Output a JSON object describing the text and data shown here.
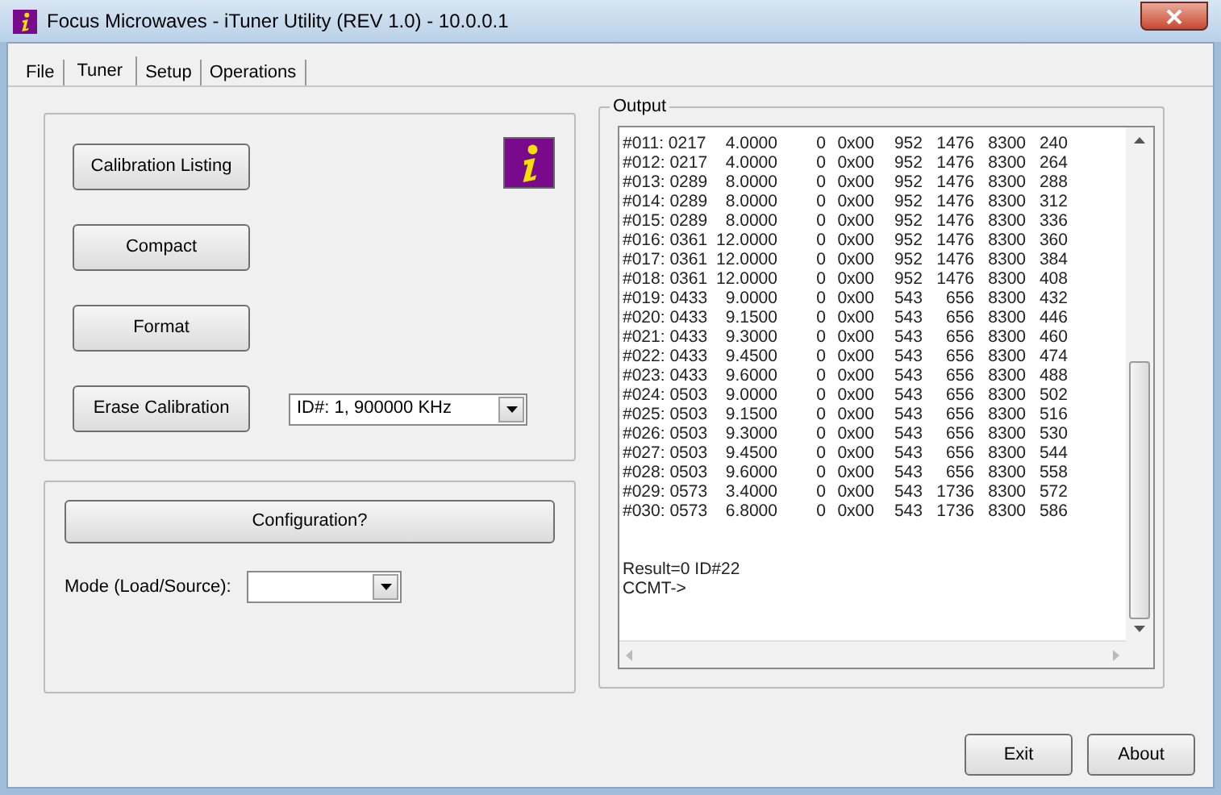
{
  "window": {
    "title": "Focus Microwaves - iTuner Utility (REV 1.0) - 10.0.0.1"
  },
  "tabs": [
    {
      "label": "File",
      "selected": false
    },
    {
      "label": "Tuner",
      "selected": true
    },
    {
      "label": "Setup",
      "selected": false
    },
    {
      "label": "Operations",
      "selected": false
    }
  ],
  "tuner_panel": {
    "buttons": [
      "Calibration Listing",
      "Compact",
      "Format",
      "Erase Calibration"
    ],
    "calibration_select": {
      "value": "ID#: 1, 900000 KHz"
    }
  },
  "config_panel": {
    "button": "Configuration?",
    "mode_label": "Mode (Load/Source):"
  },
  "output": {
    "title": "Output",
    "rows": [
      [
        "#011: 0217",
        "4.0000",
        "0",
        "0x00",
        "952",
        "1476",
        "8300",
        "240"
      ],
      [
        "#012: 0217",
        "4.0000",
        "0",
        "0x00",
        "952",
        "1476",
        "8300",
        "264"
      ],
      [
        "#013: 0289",
        "8.0000",
        "0",
        "0x00",
        "952",
        "1476",
        "8300",
        "288"
      ],
      [
        "#014: 0289",
        "8.0000",
        "0",
        "0x00",
        "952",
        "1476",
        "8300",
        "312"
      ],
      [
        "#015: 0289",
        "8.0000",
        "0",
        "0x00",
        "952",
        "1476",
        "8300",
        "336"
      ],
      [
        "#016: 0361",
        "12.0000",
        "0",
        "0x00",
        "952",
        "1476",
        "8300",
        "360"
      ],
      [
        "#017: 0361",
        "12.0000",
        "0",
        "0x00",
        "952",
        "1476",
        "8300",
        "384"
      ],
      [
        "#018: 0361",
        "12.0000",
        "0",
        "0x00",
        "952",
        "1476",
        "8300",
        "408"
      ],
      [
        "#019: 0433",
        "9.0000",
        "0",
        "0x00",
        "543",
        "656",
        "8300",
        "432"
      ],
      [
        "#020: 0433",
        "9.1500",
        "0",
        "0x00",
        "543",
        "656",
        "8300",
        "446"
      ],
      [
        "#021: 0433",
        "9.3000",
        "0",
        "0x00",
        "543",
        "656",
        "8300",
        "460"
      ],
      [
        "#022: 0433",
        "9.4500",
        "0",
        "0x00",
        "543",
        "656",
        "8300",
        "474"
      ],
      [
        "#023: 0433",
        "9.6000",
        "0",
        "0x00",
        "543",
        "656",
        "8300",
        "488"
      ],
      [
        "#024: 0503",
        "9.0000",
        "0",
        "0x00",
        "543",
        "656",
        "8300",
        "502"
      ],
      [
        "#025: 0503",
        "9.1500",
        "0",
        "0x00",
        "543",
        "656",
        "8300",
        "516"
      ],
      [
        "#026: 0503",
        "9.3000",
        "0",
        "0x00",
        "543",
        "656",
        "8300",
        "530"
      ],
      [
        "#027: 0503",
        "9.4500",
        "0",
        "0x00",
        "543",
        "656",
        "8300",
        "544"
      ],
      [
        "#028: 0503",
        "9.6000",
        "0",
        "0x00",
        "543",
        "656",
        "8300",
        "558"
      ],
      [
        "#029: 0573",
        "3.4000",
        "0",
        "0x00",
        "543",
        "1736",
        "8300",
        "572"
      ],
      [
        "#030: 0573",
        "6.8000",
        "0",
        "0x00",
        "543",
        "1736",
        "8300",
        "586"
      ]
    ],
    "result": "Result=0 ID#22",
    "prompt": "CCMT->"
  },
  "footer_buttons": [
    "Exit",
    "About"
  ]
}
